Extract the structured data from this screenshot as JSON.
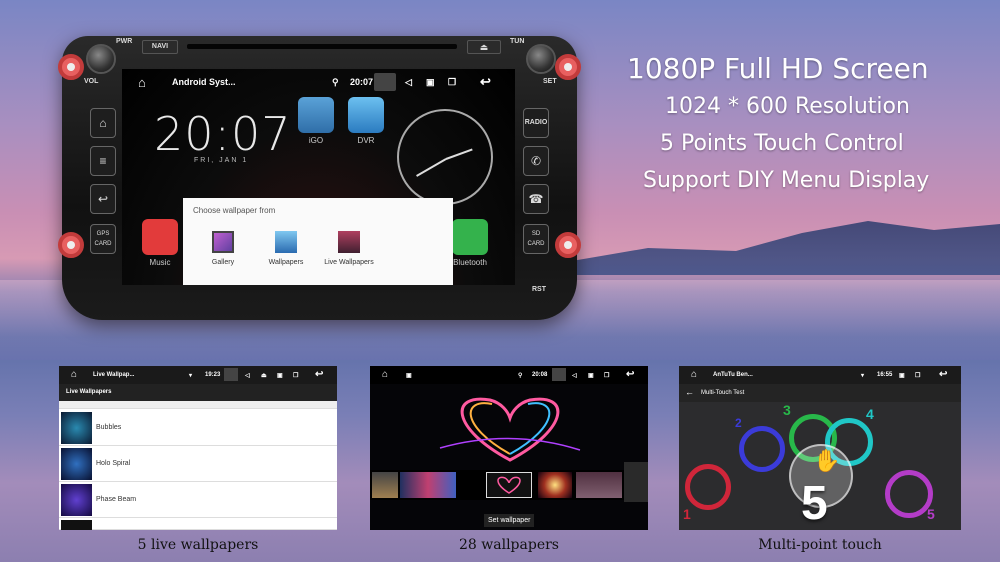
{
  "colors": {
    "accent_red": "#d0263a",
    "touch_blue": "#3b3bd9",
    "touch_green": "#28b84a",
    "touch_cyan": "#20c7c7",
    "touch_purple": "#b43cc8"
  },
  "head_unit": {
    "labels": {
      "pwr": "PWR",
      "navi": "NAVI",
      "tun": "TUN",
      "vol": "VOL",
      "set": "SET",
      "radio": "RADIO",
      "gps": "GPS\nCARD",
      "sd": "SD\nCARD",
      "rst": "RST"
    },
    "screen": {
      "status_title": "Android Syst...",
      "status_time": "20:07",
      "clock": "20:07",
      "date": "FRI, JAN 1",
      "apps": {
        "igo": "iGO",
        "dvr": "DVR",
        "music": "Music",
        "bluetooth": "Bluetooth"
      },
      "dialog": {
        "title": "Choose wallpaper from",
        "options": [
          "Gallery",
          "Wallpapers",
          "Live Wallpapers"
        ]
      }
    }
  },
  "features": [
    "1080P Full HD Screen",
    "1024 * 600 Resolution",
    "5 Points Touch Control",
    "Support DIY Menu Display"
  ],
  "panels": [
    {
      "status_title": "Live Wallpap...",
      "status_time": "19:23",
      "header": "Live Wallpapers",
      "items": [
        "Bubbles",
        "Holo Spiral",
        "Phase Beam"
      ],
      "caption": "5 live wallpapers"
    },
    {
      "status_time": "20:08",
      "button": "Set wallpaper",
      "caption": "28 wallpapers"
    },
    {
      "status_title": "AnTuTu Ben...",
      "status_time": "16:55",
      "header": "Multi-Touch Test",
      "points": [
        "1",
        "2",
        "3",
        "4",
        "5"
      ],
      "big_number": "5",
      "caption": "Multi-point touch"
    }
  ],
  "icons": [
    "home-icon",
    "back-icon",
    "menu-icon",
    "phone-icon",
    "hangup-icon",
    "location-icon",
    "wifi-icon",
    "volume-icon",
    "screenshot-icon",
    "eject-icon"
  ]
}
